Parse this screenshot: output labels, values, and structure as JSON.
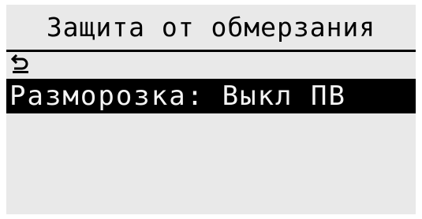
{
  "header": {
    "title": "Защита от обмерзания"
  },
  "back_button": {
    "icon": "return-arrow-icon"
  },
  "menu": {
    "items": [
      {
        "label": "Разморозка: Выкл ПВ",
        "selected": true
      }
    ]
  },
  "colors": {
    "screen_background": "#e9e9e9",
    "foreground": "#000000",
    "selected_text": "#f4f4f4"
  }
}
